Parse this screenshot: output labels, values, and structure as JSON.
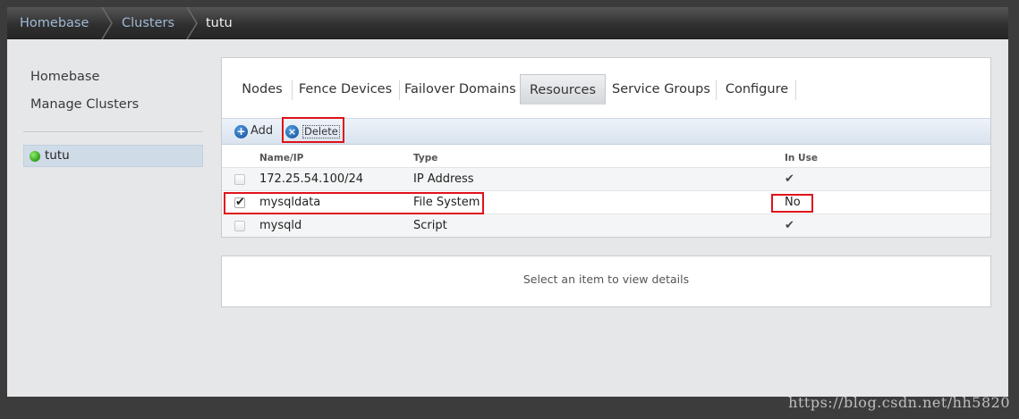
{
  "breadcrumb": [
    "Homebase",
    "Clusters",
    "tutu"
  ],
  "sidebar": {
    "links": [
      "Homebase",
      "Manage Clusters"
    ],
    "clusters": [
      {
        "label": "tutu",
        "status": "running"
      }
    ]
  },
  "tabs": [
    "Nodes",
    "Fence Devices",
    "Failover Domains",
    "Resources",
    "Service Groups",
    "Configure"
  ],
  "active_tab": "Resources",
  "toolbar": {
    "add_label": "Add",
    "delete_label": "Delete"
  },
  "table": {
    "columns": [
      "Name/IP",
      "Type",
      "In Use"
    ],
    "rows": [
      {
        "name": "172.25.54.100/24",
        "type": "IP Address",
        "in_use": "✔",
        "checked": false
      },
      {
        "name": "mysqldata",
        "type": "File System",
        "in_use": "No",
        "checked": true
      },
      {
        "name": "mysqld",
        "type": "Script",
        "in_use": "✔",
        "checked": false
      }
    ]
  },
  "details": {
    "placeholder": "Select an item to view details"
  },
  "watermark": "https://blog.csdn.net/hh5820",
  "colors": {
    "highlight": "#e0121b",
    "link": "#9fb9d6",
    "status_ok": "#2f9e1b"
  }
}
